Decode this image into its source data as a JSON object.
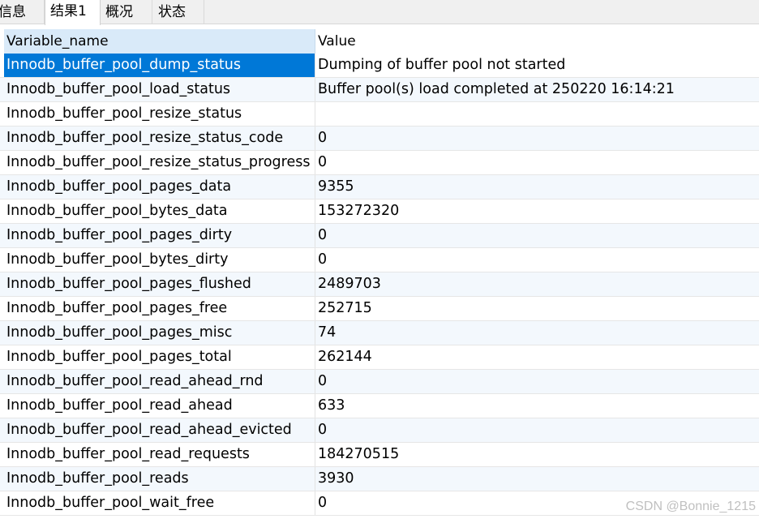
{
  "tabs": [
    {
      "label": "信息",
      "active": false
    },
    {
      "label": "结果1",
      "active": true
    },
    {
      "label": "概况",
      "active": false
    },
    {
      "label": "状态",
      "active": false
    }
  ],
  "table": {
    "columns": [
      "Variable_name",
      "Value"
    ],
    "selected_row": 0,
    "rows": [
      {
        "name": "Innodb_buffer_pool_dump_status",
        "value": "Dumping of buffer pool not started"
      },
      {
        "name": "Innodb_buffer_pool_load_status",
        "value": "Buffer pool(s) load completed at 250220 16:14:21"
      },
      {
        "name": "Innodb_buffer_pool_resize_status",
        "value": ""
      },
      {
        "name": "Innodb_buffer_pool_resize_status_code",
        "value": "0"
      },
      {
        "name": "Innodb_buffer_pool_resize_status_progress",
        "value": "0"
      },
      {
        "name": "Innodb_buffer_pool_pages_data",
        "value": "9355"
      },
      {
        "name": "Innodb_buffer_pool_bytes_data",
        "value": "153272320"
      },
      {
        "name": "Innodb_buffer_pool_pages_dirty",
        "value": "0"
      },
      {
        "name": "Innodb_buffer_pool_bytes_dirty",
        "value": "0"
      },
      {
        "name": "Innodb_buffer_pool_pages_flushed",
        "value": "2489703"
      },
      {
        "name": "Innodb_buffer_pool_pages_free",
        "value": "252715"
      },
      {
        "name": "Innodb_buffer_pool_pages_misc",
        "value": "74"
      },
      {
        "name": "Innodb_buffer_pool_pages_total",
        "value": "262144"
      },
      {
        "name": "Innodb_buffer_pool_read_ahead_rnd",
        "value": "0"
      },
      {
        "name": "Innodb_buffer_pool_read_ahead",
        "value": "633"
      },
      {
        "name": "Innodb_buffer_pool_read_ahead_evicted",
        "value": "0"
      },
      {
        "name": "Innodb_buffer_pool_read_requests",
        "value": "184270515"
      },
      {
        "name": "Innodb_buffer_pool_reads",
        "value": "3930"
      },
      {
        "name": "Innodb_buffer_pool_wait_free",
        "value": "0"
      }
    ]
  },
  "watermark": "CSDN @Bonnie_1215",
  "colors": {
    "selection": "#0078d7",
    "header_bg": "#d9eaf9",
    "alt_row_bg": "#f3f8fd"
  }
}
